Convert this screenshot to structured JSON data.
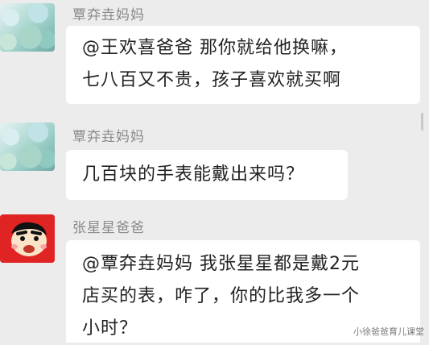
{
  "messages": [
    {
      "sender": "覃㚏垚妈妈",
      "avatar": "leaf-photo-avatar",
      "lines": [
        "@王欢喜爸爸 那你就给他换嘛，",
        "七八百又不贵，孩子喜欢就买啊"
      ]
    },
    {
      "sender": "覃㚏垚妈妈",
      "avatar": "leaf-photo-avatar",
      "lines": [
        "几百块的手表能戴出来吗？"
      ]
    },
    {
      "sender": "张星星爸爸",
      "avatar": "shin-chan-avatar",
      "lines": [
        "@覃㚏垚妈妈  我张星星都是戴2元",
        "店买的表，咋了，你的比我多一个",
        "小时？"
      ]
    }
  ],
  "watermark": "小徐爸爸育儿课堂",
  "colors": {
    "background": "#ececec",
    "bubble": "#ffffff",
    "name_text": "#8a8a8a",
    "avatar_red": "#e02424"
  }
}
